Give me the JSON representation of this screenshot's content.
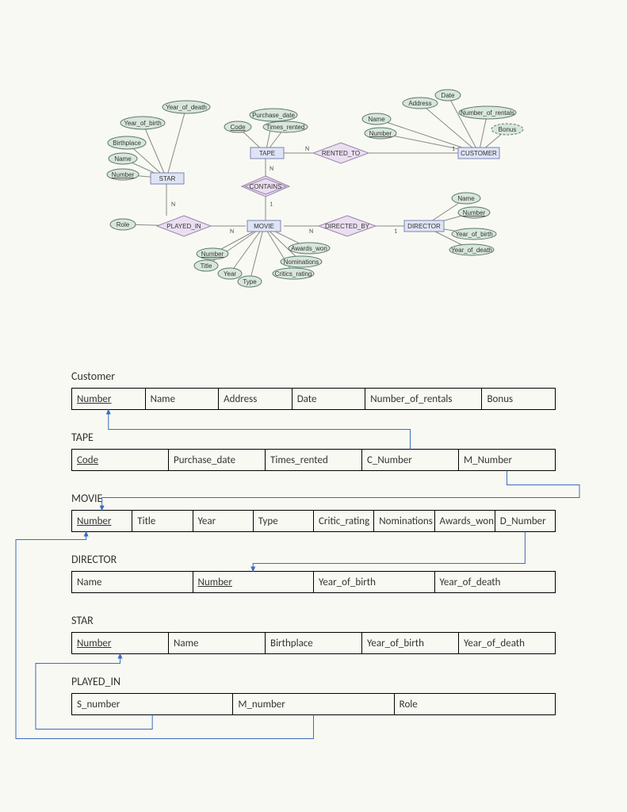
{
  "er": {
    "entities": {
      "star": "STAR",
      "tape": "TAPE",
      "customer": "CUSTOMER",
      "movie": "MOVIE",
      "director": "DIRECTOR"
    },
    "relationships": {
      "rented_to": "RENTED_TO",
      "contains": "CONTAINS",
      "played_in": "PLAYED_IN",
      "directed_by": "DIRECTED_BY"
    },
    "attrs": {
      "star": {
        "year_of_death": "Year_of_death",
        "year_of_birth": "Year_of_birth",
        "birthplace": "Birthplace",
        "name": "Name",
        "number": "Number"
      },
      "tape": {
        "purchase_date": "Purchase_date",
        "code": "Code",
        "times_rented": "Times_rented"
      },
      "customer": {
        "address": "Address",
        "date": "Date",
        "name": "Name",
        "number_of_rentals": "Number_of_rentals",
        "number": "Number",
        "bonus": "Bonus"
      },
      "movie": {
        "number": "Number",
        "title": "Title",
        "year": "Year",
        "type": "Type",
        "critics_rating": "Critics_rating",
        "nominations": "Nominations",
        "awards_won": "Awards_won"
      },
      "played_in": {
        "role": "Role"
      },
      "director": {
        "name": "Name",
        "number": "Number",
        "year_of_birth": "Year_of_birth",
        "year_of_death": "Year_of_death"
      }
    },
    "card": {
      "N": "N",
      "one": "1"
    }
  },
  "schema": {
    "customer": {
      "title": "Customer",
      "cols": [
        "Number",
        "Name",
        "Address",
        "Date",
        "Number_of_rentals",
        "Bonus"
      ],
      "pk": [
        0
      ]
    },
    "tape": {
      "title": "TAPE",
      "cols": [
        "Code",
        "Purchase_date",
        "Times_rented",
        "C_Number",
        "M_Number"
      ],
      "pk": [
        0
      ]
    },
    "movie": {
      "title": "MOVIE",
      "cols": [
        "Number",
        "Title",
        "Year",
        "Type",
        "Critic_rating",
        "Nominations",
        "Awards_won",
        "D_Number"
      ],
      "pk": [
        0
      ]
    },
    "director": {
      "title": "DIRECTOR",
      "cols": [
        "Name",
        "Number",
        "Year_of_birth",
        "Year_of_death"
      ],
      "pk": [
        1
      ]
    },
    "star": {
      "title": "STAR",
      "cols": [
        "Number",
        "Name",
        "Birthplace",
        "Year_of_birth",
        "Year_of_death"
      ],
      "pk": [
        0
      ]
    },
    "played_in": {
      "title": "PLAYED_IN",
      "cols": [
        "S_number",
        "M_number",
        "Role"
      ],
      "pk": []
    }
  }
}
